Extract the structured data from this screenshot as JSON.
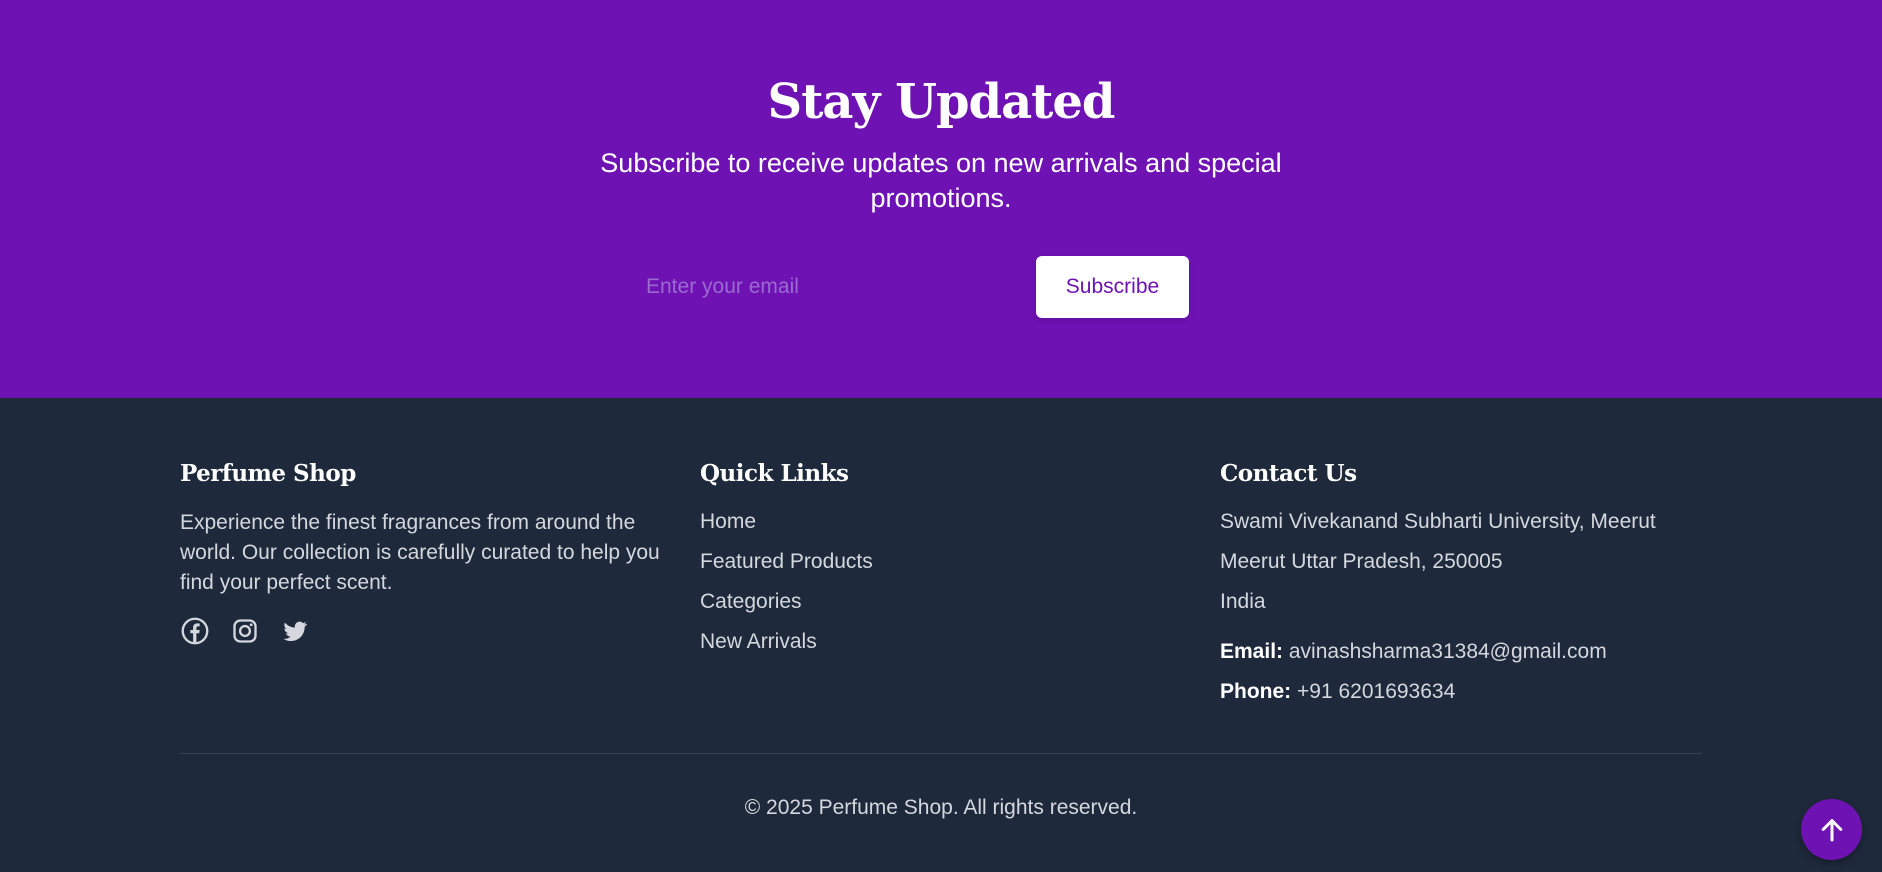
{
  "newsletter": {
    "title": "Stay Updated",
    "subtitle": "Subscribe to receive updates on new arrivals and special promotions.",
    "email_placeholder": "Enter your email",
    "subscribe_label": "Subscribe"
  },
  "footer": {
    "brand": {
      "heading": "Perfume Shop",
      "description": "Experience the finest fragrances from around the world. Our collection is carefully curated to help you find your perfect scent.",
      "socials": [
        "facebook-icon",
        "instagram-icon",
        "twitter-icon"
      ]
    },
    "quick_links": {
      "heading": "Quick Links",
      "items": [
        "Home",
        "Featured Products",
        "Categories",
        "New Arrivals"
      ]
    },
    "contact": {
      "heading": "Contact Us",
      "address_lines": [
        "Swami Vivekanand Subharti University, Meerut",
        "Meerut Uttar Pradesh, 250005",
        "India"
      ],
      "email_label": "Email:",
      "email": "avinashsharma31384@gmail.com",
      "phone_label": "Phone:",
      "phone": "+91 6201693634"
    },
    "copyright": "© 2025 Perfume Shop. All rights reserved."
  },
  "back_to_top": {
    "icon": "arrow-up-icon"
  },
  "colors": {
    "accent": "#6f12b3",
    "footer_bg": "#1e293b",
    "text_muted": "#d4d8de"
  }
}
